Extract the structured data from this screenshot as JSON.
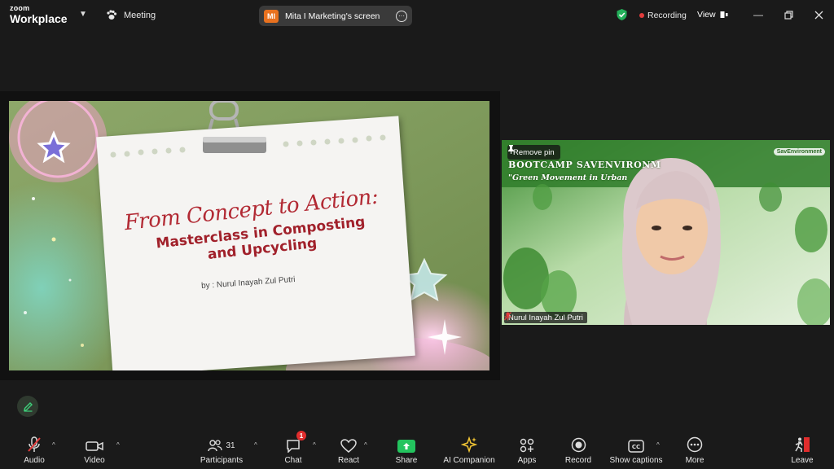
{
  "app": {
    "brand_small": "zoom",
    "brand_large": "Workplace"
  },
  "header": {
    "meeting_label": "Meeting",
    "share_initials": "MI",
    "share_label": "Mita I Marketing's screen",
    "recording_label": "Recording",
    "view_label": "View"
  },
  "slide": {
    "title_script": "From Concept to Action:",
    "title_line1": "Masterclass in Composting",
    "title_line2": "and Upcycling",
    "byline": "by : Nurul Inayah Zul Putri"
  },
  "video": {
    "remove_pin_label": "Remove pin",
    "banner_line1": "BOOTCAMP SAVENVIRONM",
    "banner_line2": "\"Green Movement in Urban",
    "logo_text": "SavEnvironment",
    "participant_name": "Nurul Inayah Zul Putri"
  },
  "toolbar": {
    "audio": "Audio",
    "video": "Video",
    "participants": "Participants",
    "participants_count": "31",
    "chat": "Chat",
    "chat_badge": "1",
    "react": "React",
    "share": "Share",
    "ai_companion": "AI Companion",
    "apps": "Apps",
    "record": "Record",
    "captions": "Show captions",
    "more": "More",
    "leave": "Leave"
  },
  "colors": {
    "share_green": "#23c45e",
    "record_red": "#e23c3c",
    "slide_title_red": "#a1212b",
    "leave_red": "#e02d2d"
  }
}
